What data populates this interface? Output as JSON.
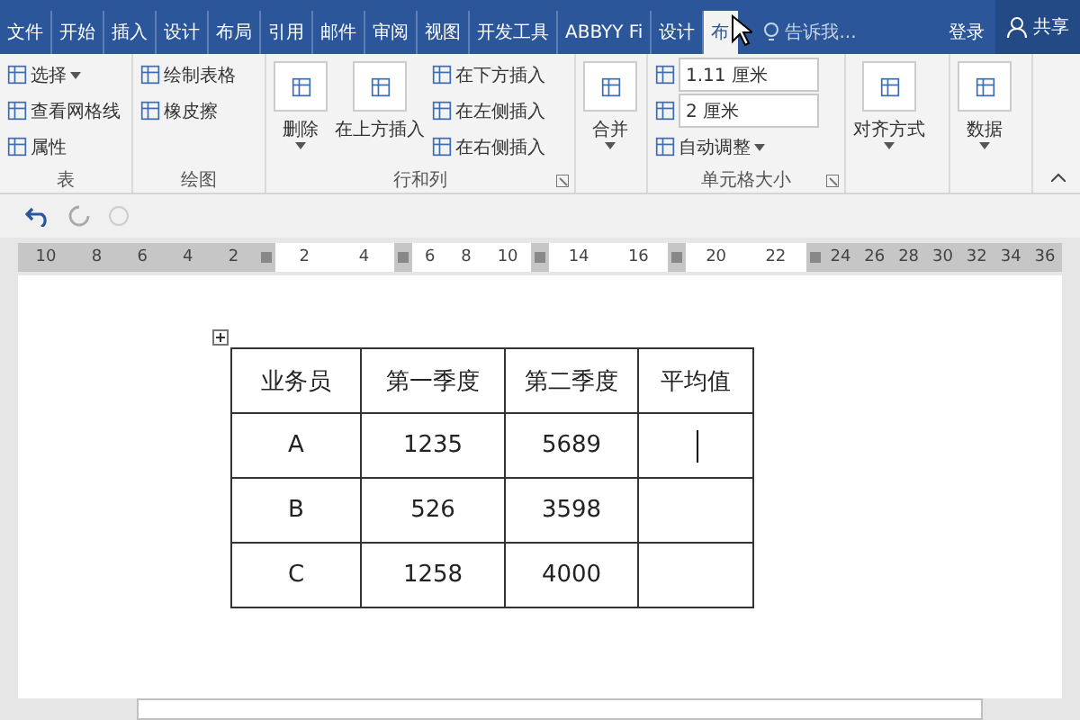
{
  "tabs": [
    {
      "label": "文件",
      "selected": false
    },
    {
      "label": "开始",
      "selected": false
    },
    {
      "label": "插入",
      "selected": false
    },
    {
      "label": "设计",
      "selected": false
    },
    {
      "label": "布局",
      "selected": false
    },
    {
      "label": "引用",
      "selected": false
    },
    {
      "label": "邮件",
      "selected": false
    },
    {
      "label": "审阅",
      "selected": false
    },
    {
      "label": "视图",
      "selected": false
    },
    {
      "label": "开发工具",
      "selected": false
    },
    {
      "label": "ABBYY Fi",
      "selected": false
    },
    {
      "label": "设计",
      "selected": false
    },
    {
      "label": "布",
      "selected": true
    }
  ],
  "tell_me": {
    "placeholder": "告诉我..."
  },
  "sign_in": "登录",
  "share": "共享",
  "ribbon": {
    "groups": [
      {
        "label": "表",
        "items": [
          {
            "kind": "small",
            "label": "选择",
            "dropdown": true
          },
          {
            "kind": "small",
            "label": "查看网格线",
            "dropdown": false
          },
          {
            "kind": "small",
            "label": "属性",
            "dropdown": false
          }
        ]
      },
      {
        "label": "绘图",
        "items": [
          {
            "kind": "small",
            "label": "绘制表格",
            "dropdown": false
          },
          {
            "kind": "small",
            "label": "橡皮擦",
            "dropdown": false
          }
        ]
      },
      {
        "label": "行和列",
        "launcher": true,
        "items": [
          {
            "kind": "large",
            "label": "删除",
            "dropdown": true
          },
          {
            "kind": "large",
            "label": "在上方插入",
            "dropdown": false
          },
          {
            "kind": "stack",
            "items": [
              {
                "kind": "small",
                "label": "在下方插入",
                "dropdown": false
              },
              {
                "kind": "small",
                "label": "在左侧插入",
                "dropdown": false
              },
              {
                "kind": "small",
                "label": "在右侧插入",
                "dropdown": false
              }
            ]
          }
        ]
      },
      {
        "items": [
          {
            "kind": "large",
            "label": "合并",
            "dropdown": true
          }
        ]
      },
      {
        "label": "单元格大小",
        "launcher": true,
        "items": [
          {
            "kind": "spinners",
            "items": [
              {
                "value": "1.11 厘米"
              },
              {
                "value": "2 厘米"
              }
            ],
            "label": "自动调整"
          }
        ]
      },
      {
        "items": [
          {
            "kind": "large",
            "label": "对齐方式",
            "dropdown": true
          }
        ]
      },
      {
        "items": [
          {
            "kind": "large",
            "label": "数据",
            "dropdown": true
          }
        ]
      }
    ]
  },
  "ruler": [
    {
      "kind": "margin",
      "labels": [
        "10",
        "8",
        "6",
        "4",
        "2"
      ]
    },
    {
      "kind": "cell",
      "labels": [
        "2",
        "4"
      ]
    },
    {
      "kind": "cell",
      "labels": [
        "6",
        "8",
        "10"
      ]
    },
    {
      "kind": "cell",
      "labels": [
        "14",
        "16"
      ]
    },
    {
      "kind": "cell",
      "labels": [
        "20",
        "22"
      ]
    },
    {
      "kind": "margin",
      "labels": [
        "24",
        "26",
        "28",
        "30",
        "32",
        "34",
        "36"
      ]
    }
  ],
  "table": {
    "header": [
      "业务员",
      "第一季度",
      "第二季度",
      "平均值"
    ],
    "rows": [
      {
        "cells": [
          "A",
          "1235",
          "5689"
        ],
        "editing": true
      },
      {
        "cells": [
          "B",
          "526",
          "3598"
        ],
        "editing": false
      },
      {
        "cells": [
          "C",
          "1258",
          "4000"
        ],
        "editing": false
      }
    ]
  }
}
